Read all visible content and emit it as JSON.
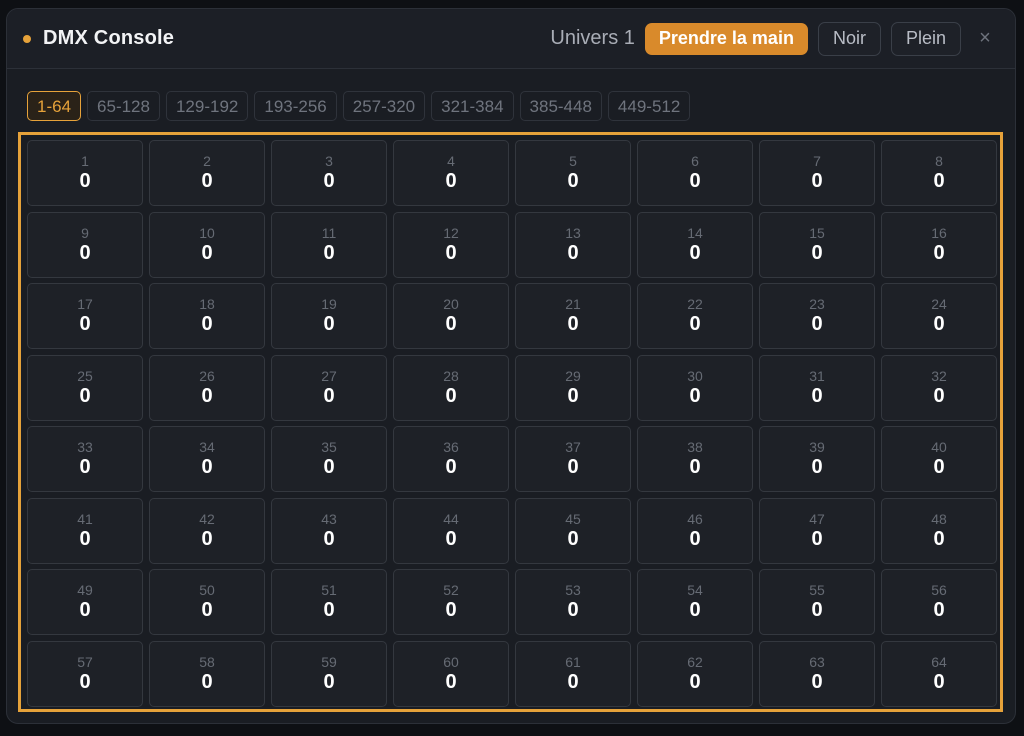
{
  "window": {
    "title": "DMX Console",
    "status_dot_color": "#e6a23a",
    "universe_label": "Univers 1",
    "take_control_label": "Prendre la main",
    "take_control_color": "#d98a2b",
    "blackout_label": "Noir",
    "full_label": "Plein",
    "close_symbol": "×"
  },
  "tabs": [
    {
      "label": "1-64",
      "active": true
    },
    {
      "label": "65-128",
      "active": false
    },
    {
      "label": "129-192",
      "active": false
    },
    {
      "label": "193-256",
      "active": false
    },
    {
      "label": "257-320",
      "active": false
    },
    {
      "label": "321-384",
      "active": false
    },
    {
      "label": "385-448",
      "active": false
    },
    {
      "label": "449-512",
      "active": false
    }
  ],
  "accent_color": "#e6a23a",
  "channels": [
    {
      "ch": "1",
      "value": "0"
    },
    {
      "ch": "2",
      "value": "0"
    },
    {
      "ch": "3",
      "value": "0"
    },
    {
      "ch": "4",
      "value": "0"
    },
    {
      "ch": "5",
      "value": "0"
    },
    {
      "ch": "6",
      "value": "0"
    },
    {
      "ch": "7",
      "value": "0"
    },
    {
      "ch": "8",
      "value": "0"
    },
    {
      "ch": "9",
      "value": "0"
    },
    {
      "ch": "10",
      "value": "0"
    },
    {
      "ch": "11",
      "value": "0"
    },
    {
      "ch": "12",
      "value": "0"
    },
    {
      "ch": "13",
      "value": "0"
    },
    {
      "ch": "14",
      "value": "0"
    },
    {
      "ch": "15",
      "value": "0"
    },
    {
      "ch": "16",
      "value": "0"
    },
    {
      "ch": "17",
      "value": "0"
    },
    {
      "ch": "18",
      "value": "0"
    },
    {
      "ch": "19",
      "value": "0"
    },
    {
      "ch": "20",
      "value": "0"
    },
    {
      "ch": "21",
      "value": "0"
    },
    {
      "ch": "22",
      "value": "0"
    },
    {
      "ch": "23",
      "value": "0"
    },
    {
      "ch": "24",
      "value": "0"
    },
    {
      "ch": "25",
      "value": "0"
    },
    {
      "ch": "26",
      "value": "0"
    },
    {
      "ch": "27",
      "value": "0"
    },
    {
      "ch": "28",
      "value": "0"
    },
    {
      "ch": "29",
      "value": "0"
    },
    {
      "ch": "30",
      "value": "0"
    },
    {
      "ch": "31",
      "value": "0"
    },
    {
      "ch": "32",
      "value": "0"
    },
    {
      "ch": "33",
      "value": "0"
    },
    {
      "ch": "34",
      "value": "0"
    },
    {
      "ch": "35",
      "value": "0"
    },
    {
      "ch": "36",
      "value": "0"
    },
    {
      "ch": "37",
      "value": "0"
    },
    {
      "ch": "38",
      "value": "0"
    },
    {
      "ch": "39",
      "value": "0"
    },
    {
      "ch": "40",
      "value": "0"
    },
    {
      "ch": "41",
      "value": "0"
    },
    {
      "ch": "42",
      "value": "0"
    },
    {
      "ch": "43",
      "value": "0"
    },
    {
      "ch": "44",
      "value": "0"
    },
    {
      "ch": "45",
      "value": "0"
    },
    {
      "ch": "46",
      "value": "0"
    },
    {
      "ch": "47",
      "value": "0"
    },
    {
      "ch": "48",
      "value": "0"
    },
    {
      "ch": "49",
      "value": "0"
    },
    {
      "ch": "50",
      "value": "0"
    },
    {
      "ch": "51",
      "value": "0"
    },
    {
      "ch": "52",
      "value": "0"
    },
    {
      "ch": "53",
      "value": "0"
    },
    {
      "ch": "54",
      "value": "0"
    },
    {
      "ch": "55",
      "value": "0"
    },
    {
      "ch": "56",
      "value": "0"
    },
    {
      "ch": "57",
      "value": "0"
    },
    {
      "ch": "58",
      "value": "0"
    },
    {
      "ch": "59",
      "value": "0"
    },
    {
      "ch": "60",
      "value": "0"
    },
    {
      "ch": "61",
      "value": "0"
    },
    {
      "ch": "62",
      "value": "0"
    },
    {
      "ch": "63",
      "value": "0"
    },
    {
      "ch": "64",
      "value": "0"
    }
  ]
}
